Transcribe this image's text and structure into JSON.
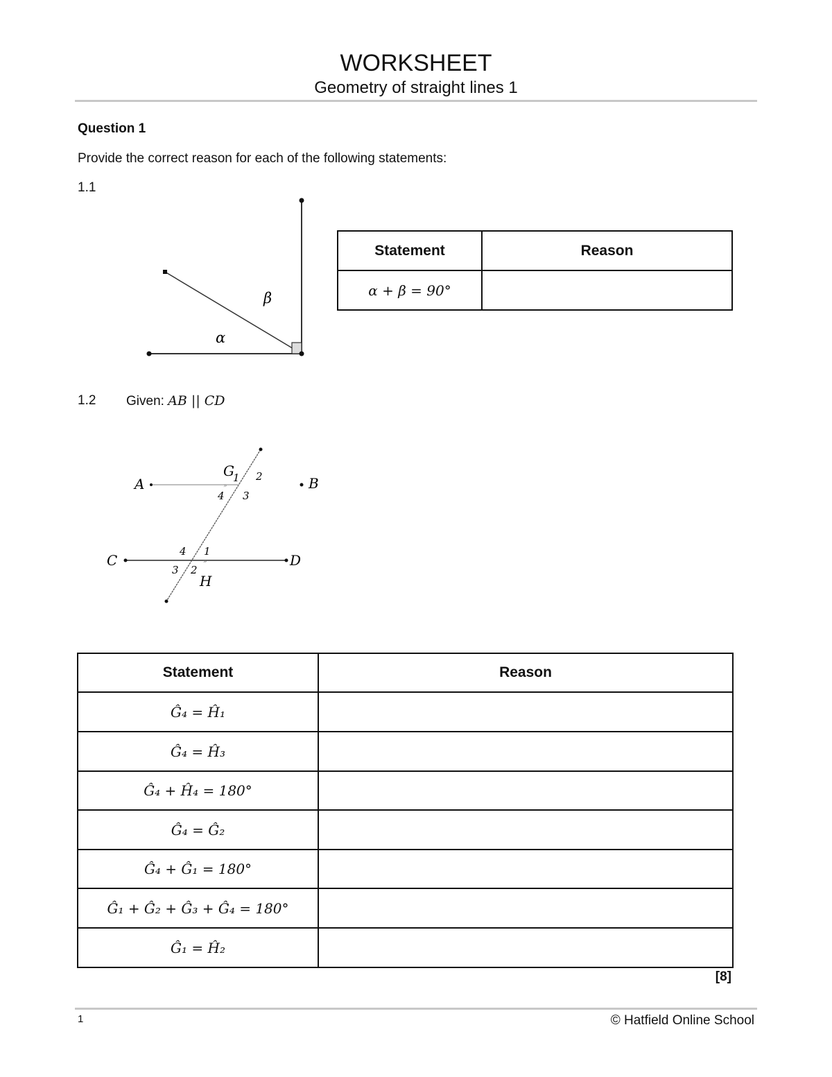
{
  "header": {
    "title": "WORKSHEET",
    "subtitle": "Geometry of straight lines 1"
  },
  "question": {
    "title": "Question 1",
    "instruction": "Provide the correct reason for each of the following statements:"
  },
  "q1_1": {
    "number": "1.1",
    "diagram": {
      "alpha": "α",
      "beta": "β"
    },
    "table": {
      "headers": [
        "Statement",
        "Reason"
      ],
      "rows": [
        {
          "statement": "α + β = 90°",
          "reason": ""
        }
      ]
    }
  },
  "q1_2": {
    "number": "1.2",
    "given_label": "Given:",
    "given_expr": "AB || CD",
    "diagram": {
      "A": "A",
      "B": "B",
      "C": "C",
      "D": "D",
      "G": "G",
      "H": "H",
      "G_angles": [
        "1",
        "2",
        "3",
        "4"
      ],
      "H_angles": [
        "1",
        "2",
        "3",
        "4"
      ]
    },
    "table": {
      "headers": [
        "Statement",
        "Reason"
      ],
      "rows": [
        {
          "statement": "Ĝ₄ = Ĥ₁",
          "reason": ""
        },
        {
          "statement": "Ĝ₄ = Ĥ₃",
          "reason": ""
        },
        {
          "statement": "Ĝ₄ + Ĥ₄ = 180°",
          "reason": ""
        },
        {
          "statement": "Ĝ₄ = Ĝ₂",
          "reason": ""
        },
        {
          "statement": "Ĝ₄ + Ĝ₁ = 180°",
          "reason": ""
        },
        {
          "statement": "Ĝ₁ + Ĝ₂ + Ĝ₃ + Ĝ₄ = 180°",
          "reason": ""
        },
        {
          "statement": "Ĝ₁ = Ĥ₂",
          "reason": ""
        }
      ]
    },
    "marks": "[8]"
  },
  "footer": {
    "page_number": "1",
    "copyright": "© Hatfield Online School"
  }
}
